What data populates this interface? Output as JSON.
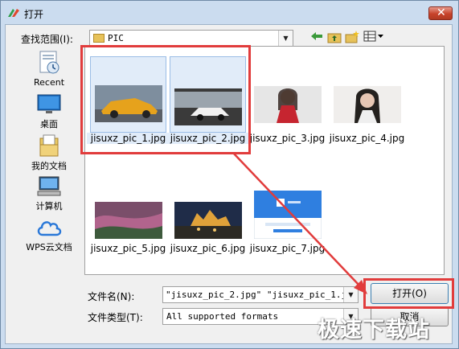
{
  "window": {
    "title": "打开",
    "close_symbol": "✕"
  },
  "lookin": {
    "label": "查找范围(I):",
    "value": "PIC"
  },
  "places": [
    {
      "label": "Recent",
      "icon": "recent-icon"
    },
    {
      "label": "桌面",
      "icon": "desktop-icon"
    },
    {
      "label": "我的文档",
      "icon": "documents-icon"
    },
    {
      "label": "计算机",
      "icon": "computer-icon"
    },
    {
      "label": "WPS云文档",
      "icon": "cloud-icon"
    }
  ],
  "files": [
    {
      "name": "jisuxz_pic_1.jpg",
      "selected": true
    },
    {
      "name": "jisuxz_pic_2.jpg",
      "selected": true
    },
    {
      "name": "jisuxz_pic_3.jpg",
      "selected": false
    },
    {
      "name": "jisuxz_pic_4.jpg",
      "selected": false
    },
    {
      "name": "jisuxz_pic_5.jpg",
      "selected": false
    },
    {
      "name": "jisuxz_pic_6.jpg",
      "selected": false
    },
    {
      "name": "jisuxz_pic_7.jpg",
      "selected": false
    }
  ],
  "filename": {
    "label": "文件名(N):",
    "value": "\"jisuxz_pic_2.jpg\" \"jisuxz_pic_1.jpg\""
  },
  "filetype": {
    "label": "文件类型(T):",
    "value": "All supported formats"
  },
  "buttons": {
    "open": "打开(O)",
    "cancel": "取消"
  },
  "watermark": "极速下载站",
  "colors": {
    "highlight_red": "#e13c3c",
    "selection_blue": "#e1ecf9"
  }
}
